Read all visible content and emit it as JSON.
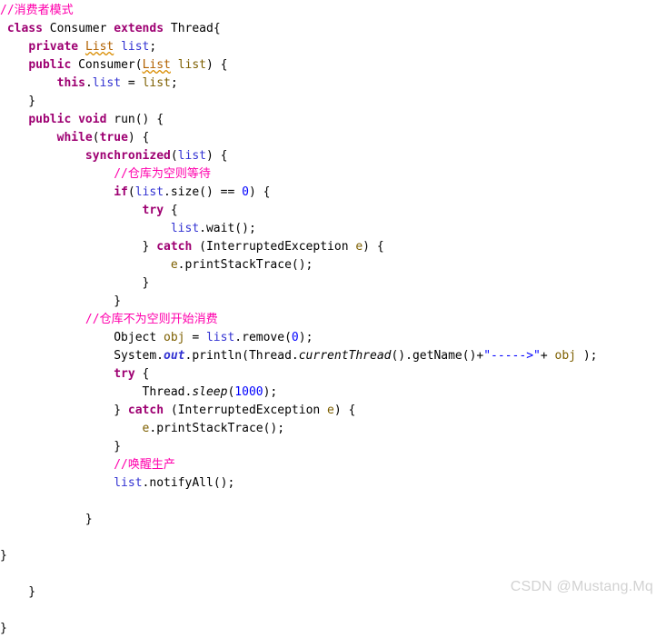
{
  "document": {
    "language": "Java",
    "theme": "light",
    "class_name": "Consumer",
    "watermark": "CSDN @Mustang.Mq"
  },
  "colors": {
    "background": "#ffffff",
    "keyword": "#9e0072",
    "comment": "#ff00ac",
    "field": "#3232d2",
    "string": "#0000ff",
    "number": "#0000ff",
    "type_error": "#b26100",
    "local_variable": "#7d5f00",
    "plain_text": "#000000",
    "squiggle": "#d98c00",
    "watermark": "#d2d2d2"
  },
  "code": {
    "lines": [
      {
        "n": 1,
        "tokens": [
          {
            "t": "//消费者模式",
            "c": "comment"
          }
        ]
      },
      {
        "n": 2,
        "tokens": [
          {
            "t": " ",
            "c": "plain"
          },
          {
            "t": "class",
            "c": "keyword"
          },
          {
            "t": " Consumer ",
            "c": "ident"
          },
          {
            "t": "extends",
            "c": "keyword"
          },
          {
            "t": " Thread{",
            "c": "ident"
          }
        ]
      },
      {
        "n": 3,
        "tokens": [
          {
            "t": "    ",
            "c": "plain"
          },
          {
            "t": "private",
            "c": "keyword"
          },
          {
            "t": " ",
            "c": "plain"
          },
          {
            "t": "List",
            "c": "type-err-squiggle"
          },
          {
            "t": " ",
            "c": "plain"
          },
          {
            "t": "list",
            "c": "field"
          },
          {
            "t": ";",
            "c": "plain"
          }
        ]
      },
      {
        "n": 4,
        "tokens": [
          {
            "t": "    ",
            "c": "plain"
          },
          {
            "t": "public",
            "c": "keyword"
          },
          {
            "t": " Consumer(",
            "c": "ident"
          },
          {
            "t": "List",
            "c": "type-err-squiggle"
          },
          {
            "t": " ",
            "c": "plain"
          },
          {
            "t": "list",
            "c": "local"
          },
          {
            "t": ") {",
            "c": "plain"
          }
        ]
      },
      {
        "n": 5,
        "tokens": [
          {
            "t": "        ",
            "c": "plain"
          },
          {
            "t": "this",
            "c": "keyword"
          },
          {
            "t": ".",
            "c": "plain"
          },
          {
            "t": "list",
            "c": "field"
          },
          {
            "t": " = ",
            "c": "plain"
          },
          {
            "t": "list",
            "c": "local"
          },
          {
            "t": ";",
            "c": "plain"
          }
        ]
      },
      {
        "n": 6,
        "tokens": [
          {
            "t": "    }",
            "c": "plain"
          }
        ]
      },
      {
        "n": 7,
        "tokens": [
          {
            "t": "    ",
            "c": "plain"
          },
          {
            "t": "public",
            "c": "keyword"
          },
          {
            "t": " ",
            "c": "plain"
          },
          {
            "t": "void",
            "c": "keyword"
          },
          {
            "t": " run() {",
            "c": "ident"
          }
        ]
      },
      {
        "n": 8,
        "tokens": [
          {
            "t": "        ",
            "c": "plain"
          },
          {
            "t": "while",
            "c": "keyword"
          },
          {
            "t": "(",
            "c": "plain"
          },
          {
            "t": "true",
            "c": "keyword"
          },
          {
            "t": ") {",
            "c": "plain"
          }
        ]
      },
      {
        "n": 9,
        "tokens": [
          {
            "t": "            ",
            "c": "plain"
          },
          {
            "t": "synchronized",
            "c": "keyword"
          },
          {
            "t": "(",
            "c": "plain"
          },
          {
            "t": "list",
            "c": "field"
          },
          {
            "t": ") {",
            "c": "plain"
          }
        ]
      },
      {
        "n": 10,
        "tokens": [
          {
            "t": "                ",
            "c": "plain"
          },
          {
            "t": "//仓库为空则等待",
            "c": "comment"
          }
        ]
      },
      {
        "n": 11,
        "tokens": [
          {
            "t": "                ",
            "c": "plain"
          },
          {
            "t": "if",
            "c": "keyword"
          },
          {
            "t": "(",
            "c": "plain"
          },
          {
            "t": "list",
            "c": "field"
          },
          {
            "t": ".size() == ",
            "c": "plain"
          },
          {
            "t": "0",
            "c": "number"
          },
          {
            "t": ") {",
            "c": "plain"
          }
        ]
      },
      {
        "n": 12,
        "tokens": [
          {
            "t": "                    ",
            "c": "plain"
          },
          {
            "t": "try",
            "c": "keyword"
          },
          {
            "t": " {",
            "c": "plain"
          }
        ]
      },
      {
        "n": 13,
        "tokens": [
          {
            "t": "                        ",
            "c": "plain"
          },
          {
            "t": "list",
            "c": "field"
          },
          {
            "t": ".wait();",
            "c": "plain"
          }
        ]
      },
      {
        "n": 14,
        "tokens": [
          {
            "t": "                    } ",
            "c": "plain"
          },
          {
            "t": "catch",
            "c": "keyword"
          },
          {
            "t": " (InterruptedException ",
            "c": "plain"
          },
          {
            "t": "e",
            "c": "local"
          },
          {
            "t": ") {",
            "c": "plain"
          }
        ]
      },
      {
        "n": 15,
        "tokens": [
          {
            "t": "                        ",
            "c": "plain"
          },
          {
            "t": "e",
            "c": "local"
          },
          {
            "t": ".printStackTrace();",
            "c": "plain"
          }
        ]
      },
      {
        "n": 16,
        "tokens": [
          {
            "t": "                    }",
            "c": "plain"
          }
        ]
      },
      {
        "n": 17,
        "tokens": [
          {
            "t": "                }",
            "c": "plain"
          }
        ]
      },
      {
        "n": 18,
        "tokens": [
          {
            "t": "            ",
            "c": "plain"
          },
          {
            "t": "//仓库不为空则开始消费",
            "c": "comment"
          }
        ]
      },
      {
        "n": 19,
        "tokens": [
          {
            "t": "                Object ",
            "c": "plain"
          },
          {
            "t": "obj",
            "c": "local"
          },
          {
            "t": " = ",
            "c": "plain"
          },
          {
            "t": "list",
            "c": "field"
          },
          {
            "t": ".remove(",
            "c": "plain"
          },
          {
            "t": "0",
            "c": "number"
          },
          {
            "t": ");",
            "c": "plain"
          }
        ]
      },
      {
        "n": 20,
        "tokens": [
          {
            "t": "                System.",
            "c": "plain"
          },
          {
            "t": "out",
            "c": "static"
          },
          {
            "t": ".println(Thread.",
            "c": "plain"
          },
          {
            "t": "currentThread",
            "c": "static-m"
          },
          {
            "t": "().getName()+",
            "c": "plain"
          },
          {
            "t": "\"----->\"",
            "c": "string"
          },
          {
            "t": "+ ",
            "c": "plain"
          },
          {
            "t": "obj",
            "c": "local"
          },
          {
            "t": " );",
            "c": "plain"
          }
        ]
      },
      {
        "n": 21,
        "tokens": [
          {
            "t": "                ",
            "c": "plain"
          },
          {
            "t": "try",
            "c": "keyword"
          },
          {
            "t": " {",
            "c": "plain"
          }
        ]
      },
      {
        "n": 22,
        "tokens": [
          {
            "t": "                    Thread.",
            "c": "plain"
          },
          {
            "t": "sleep",
            "c": "static-m"
          },
          {
            "t": "(",
            "c": "plain"
          },
          {
            "t": "1000",
            "c": "number"
          },
          {
            "t": ");",
            "c": "plain"
          }
        ]
      },
      {
        "n": 23,
        "tokens": [
          {
            "t": "                } ",
            "c": "plain"
          },
          {
            "t": "catch",
            "c": "keyword"
          },
          {
            "t": " (InterruptedException ",
            "c": "plain"
          },
          {
            "t": "e",
            "c": "local"
          },
          {
            "t": ") {",
            "c": "plain"
          }
        ]
      },
      {
        "n": 24,
        "tokens": [
          {
            "t": "                    ",
            "c": "plain"
          },
          {
            "t": "e",
            "c": "local"
          },
          {
            "t": ".printStackTrace();",
            "c": "plain"
          }
        ]
      },
      {
        "n": 25,
        "tokens": [
          {
            "t": "                }",
            "c": "plain"
          }
        ]
      },
      {
        "n": 26,
        "tokens": [
          {
            "t": "                ",
            "c": "plain"
          },
          {
            "t": "//唤醒生产",
            "c": "comment"
          }
        ]
      },
      {
        "n": 27,
        "tokens": [
          {
            "t": "                ",
            "c": "plain"
          },
          {
            "t": "list",
            "c": "field"
          },
          {
            "t": ".notifyAll();",
            "c": "plain"
          }
        ]
      },
      {
        "n": 28,
        "tokens": []
      },
      {
        "n": 29,
        "tokens": [
          {
            "t": "            }",
            "c": "plain"
          }
        ]
      },
      {
        "n": 30,
        "tokens": []
      },
      {
        "n": 31,
        "tokens": [
          {
            "t": "}",
            "c": "plain"
          }
        ]
      },
      {
        "n": 32,
        "tokens": []
      },
      {
        "n": 33,
        "tokens": [
          {
            "t": "    }",
            "c": "plain"
          }
        ]
      },
      {
        "n": 34,
        "tokens": []
      },
      {
        "n": 35,
        "tokens": [
          {
            "t": "}",
            "c": "plain"
          }
        ]
      }
    ]
  }
}
